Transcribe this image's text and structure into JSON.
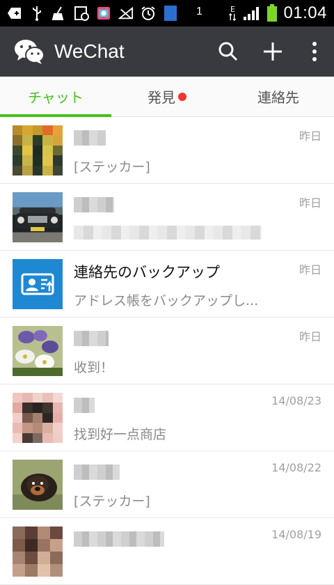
{
  "status_bar": {
    "time": "01:04",
    "sim_badge": "1",
    "network_label": "E",
    "icons": [
      "add-notification-icon",
      "usb-icon",
      "cleaner-icon",
      "screenshot-icon",
      "store-icon",
      "no-signal-icon",
      "alarm-icon",
      "sim-icon",
      "data-icon",
      "signal-icon",
      "battery-icon"
    ]
  },
  "app_bar": {
    "title": "WeChat",
    "icons": [
      "wechat-logo-icon",
      "search-icon",
      "plus-icon",
      "more-icon"
    ]
  },
  "tabs": [
    {
      "label": "チャット",
      "active": true
    },
    {
      "label": "発見",
      "badge": true
    },
    {
      "label": "連絡先"
    }
  ],
  "colors": {
    "accent": "#45c01a",
    "appbar": "#393a3f",
    "badge": "#f43530",
    "backup_tile": "#1e88d3"
  },
  "chats": [
    {
      "name": "",
      "message": "[ステッカー]",
      "time": "昨日"
    },
    {
      "name": "",
      "message": "",
      "time": "昨日"
    },
    {
      "name": "連絡先のバックアップ",
      "message": "アドレス帳をバックアップし...",
      "time": "昨日"
    },
    {
      "name": "",
      "message": "收到！",
      "time": "昨日"
    },
    {
      "name": "",
      "message": "找到好一点商店",
      "time": "14/08/23"
    },
    {
      "name": "",
      "message": "[ステッカー]",
      "time": "14/08/22"
    },
    {
      "name": "",
      "message": "",
      "time": "14/08/19"
    }
  ]
}
